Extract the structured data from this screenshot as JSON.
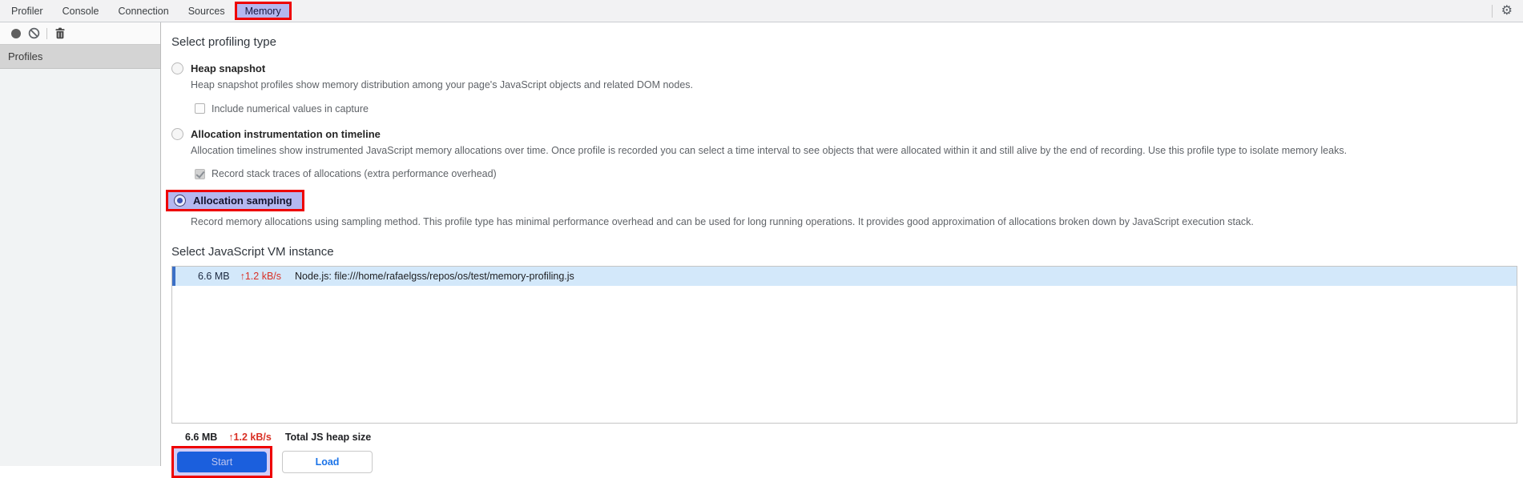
{
  "tabs": {
    "items": [
      "Profiler",
      "Console",
      "Connection",
      "Sources",
      "Memory"
    ],
    "selected": "Memory"
  },
  "toolbar": {
    "icons": [
      "record-icon",
      "clear-icon",
      "delete-icon"
    ]
  },
  "sidebar": {
    "header": "Profiles"
  },
  "profiling": {
    "heading": "Select profiling type",
    "options": [
      {
        "label": "Heap snapshot",
        "desc": "Heap snapshot profiles show memory distribution among your page's JavaScript objects and related DOM nodes.",
        "checkbox_label": "Include numerical values in capture",
        "checkbox_checked": false,
        "selected": false
      },
      {
        "label": "Allocation instrumentation on timeline",
        "desc": "Allocation timelines show instrumented JavaScript memory allocations over time. Once profile is recorded you can select a time interval to see objects that were allocated within it and still alive by the end of recording. Use this profile type to isolate memory leaks.",
        "checkbox_label": "Record stack traces of allocations (extra performance overhead)",
        "checkbox_checked": true,
        "selected": false
      },
      {
        "label": "Allocation sampling",
        "desc": "Record memory allocations using sampling method. This profile type has minimal performance overhead and can be used for long running operations. It provides good approximation of allocations broken down by JavaScript execution stack.",
        "selected": true,
        "highlighted": true
      }
    ]
  },
  "vm": {
    "heading": "Select JavaScript VM instance",
    "instances": [
      {
        "size": "6.6 MB",
        "rate": "↑1.2 kB/s",
        "name": "Node.js: file:///home/rafaelgss/repos/os/test/memory-profiling.js",
        "selected": true
      }
    ]
  },
  "stats": {
    "size": "6.6 MB",
    "rate": "↑1.2 kB/s",
    "label": "Total JS heap size"
  },
  "actions": {
    "start": "Start",
    "load": "Load"
  },
  "colors": {
    "annotation_red": "#ee0000",
    "annotation_lavender": "#b4b7ef",
    "selection_blue_bg": "#d3e8fa",
    "selection_blue_bar": "#3c70c6",
    "rate_red": "#d93025",
    "start_button_blue": "#1b5fdd",
    "link_blue": "#1a73e8"
  }
}
